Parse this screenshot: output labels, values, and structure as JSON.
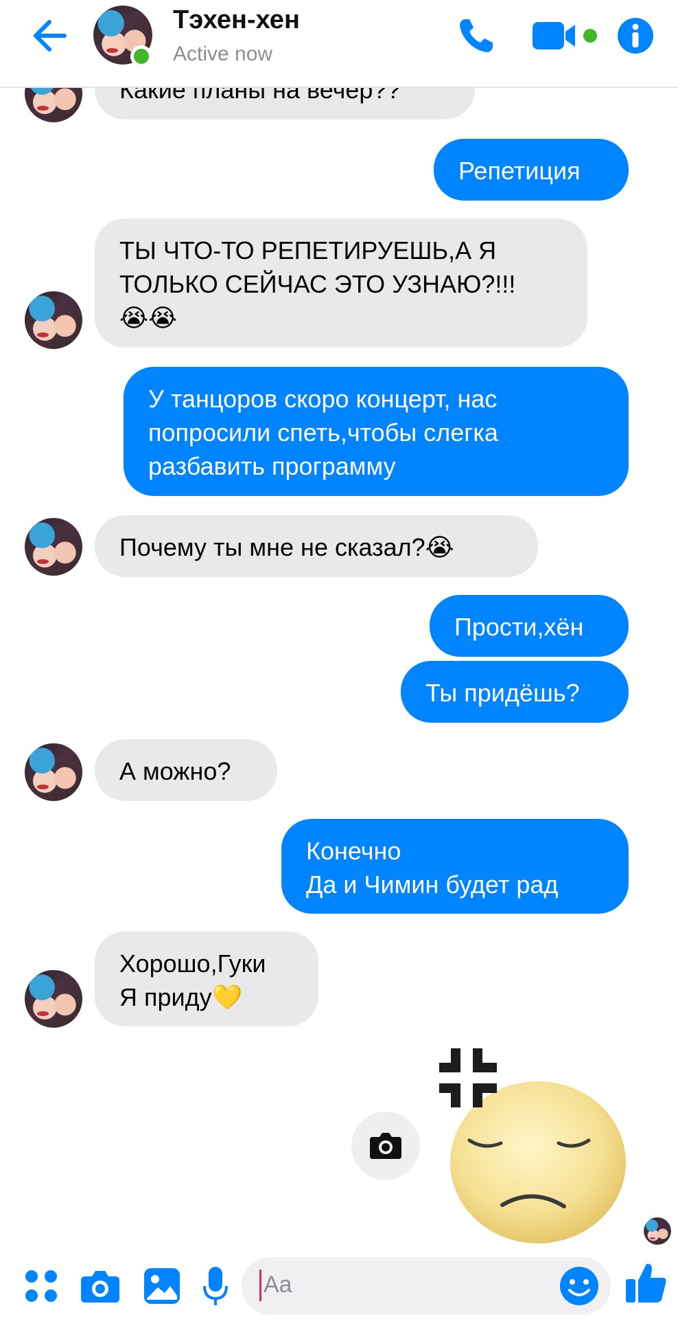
{
  "header": {
    "contact_name": "Тэхен-хен",
    "status": "Active now"
  },
  "messages": [
    {
      "side": "in",
      "text": "Какие планы на вечер??"
    },
    {
      "side": "out",
      "text": "Репетиция"
    },
    {
      "side": "in",
      "text": "ТЫ ЧТО-ТО РЕПЕТИРУЕШЬ,А Я\nТОЛЬКО СЕЙЧАС ЭТО УЗНАЮ?!!!\n😭😭"
    },
    {
      "side": "out",
      "text": "У танцоров скоро концерт, нас\nпопросили спеть,чтобы слегка\nразбавить программу"
    },
    {
      "side": "in",
      "text": "Почему ты мне не сказал?😭"
    },
    {
      "side": "out",
      "text": "Прости,хён"
    },
    {
      "side": "out",
      "text": "Ты придёшь?"
    },
    {
      "side": "in",
      "text": "А можно?"
    },
    {
      "side": "out",
      "text": "Конечно\nДа и Чимин будет рад"
    },
    {
      "side": "in",
      "text": "Хорошо,Гуки\nЯ приду💛"
    }
  ],
  "composer": {
    "placeholder": "Aa"
  },
  "colors": {
    "accent": "#0084ff",
    "incoming_bubble": "#e9e9eb",
    "online": "#42b72a"
  },
  "icons": {
    "back": "arrow-left-icon",
    "call": "phone-icon",
    "video": "video-camera-icon",
    "info": "info-icon",
    "menu": "four-dots-icon",
    "camera": "camera-icon",
    "gallery": "image-icon",
    "mic": "microphone-icon",
    "emoji": "smiley-icon",
    "like": "thumbs-up-icon"
  }
}
